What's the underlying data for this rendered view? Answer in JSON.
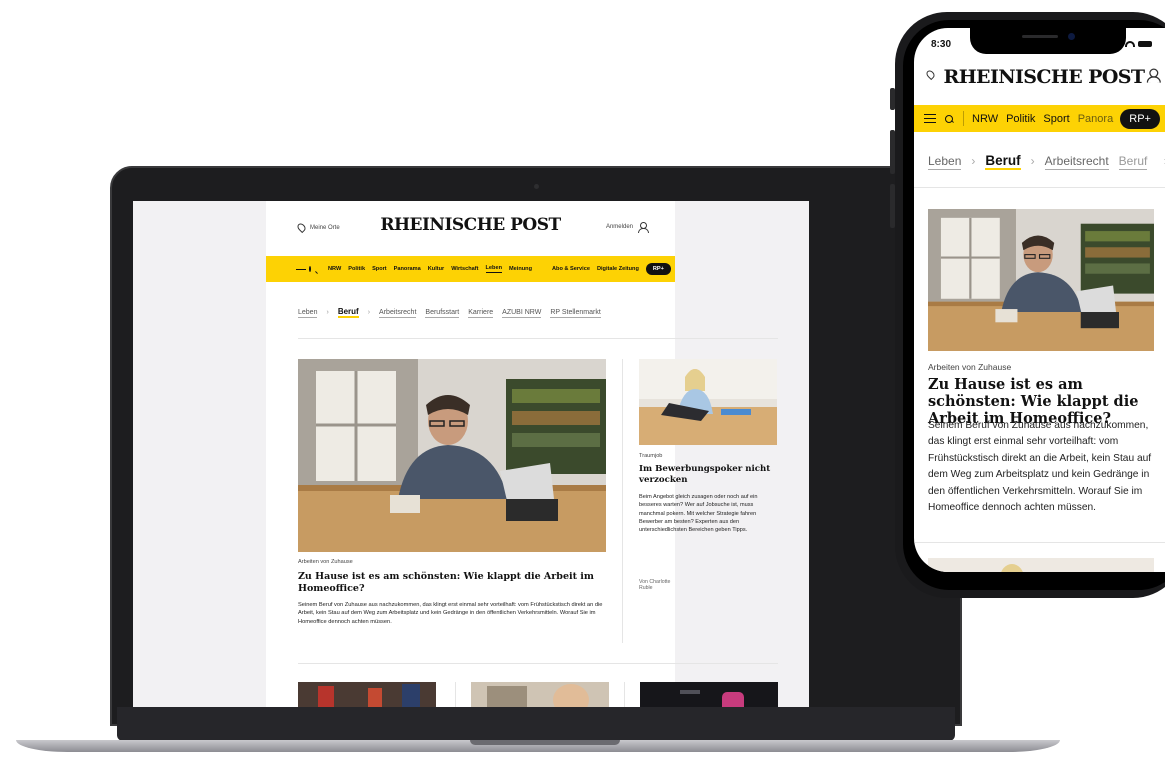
{
  "desktop": {
    "location_label": "Meine Orte",
    "logo": "RHEINISCHE POST",
    "login_label": "Anmelden",
    "nav": {
      "items": [
        "NRW",
        "Politik",
        "Sport",
        "Panorama",
        "Kultur",
        "Wirtschaft",
        "Leben",
        "Meinung",
        "Abo & Service",
        "Digitale Zeitung"
      ],
      "active": "Leben",
      "plus_label": "RP+"
    },
    "breadcrumb": {
      "parent": "Leben",
      "current": "Beruf",
      "children": [
        "Arbeitsrecht",
        "Berufsstart",
        "Karriere",
        "AZUBI NRW",
        "RP Stellenmarkt"
      ]
    },
    "lead": {
      "kicker": "Arbeiten von Zuhause",
      "headline": "Zu Hause ist es am schönsten: Wie klappt die Arbeit im Homeoffice?",
      "teaser": "Seinem Beruf von Zuhause aus nachzukommen, das klingt erst einmal sehr vorteilhaft: vom Frühstückstisch direkt an die Arbeit, kein Stau auf dem Weg zum Arbeitsplatz und kein Gedränge in den öffentlichen Verkehrsmitteln. Worauf Sie im Homeoffice dennoch achten müssen."
    },
    "second": {
      "kicker": "Traumjob",
      "headline": "Im Bewerbungspoker nicht verzocken",
      "teaser": "Beim Angebot gleich zusagen oder noch auf ein besseres warten? Wer auf Jobsuche ist, muss manchmal pokern. Mit welcher Strategie fahren Bewerber am besten? Experten aus den unterschiedlichsten Bereichen geben Tipps.",
      "author": "Von Charlotte Ruble"
    }
  },
  "mobile": {
    "time": "8:30",
    "logo": "RHEINISCHE POST",
    "nav": {
      "items": [
        "NRW",
        "Politik",
        "Sport"
      ],
      "truncated_item": "Panora",
      "plus_label": "RP+"
    },
    "breadcrumb": {
      "parent": "Leben",
      "current": "Beruf",
      "children": [
        "Arbeitsrecht",
        "Beruf"
      ]
    },
    "lead": {
      "kicker": "Arbeiten von Zuhause",
      "headline": "Zu Hause ist es am schönsten: Wie klappt die Arbeit im Homeoffice?",
      "teaser": "Seinem Beruf von Zuhause aus nachzukommen, das klingt erst einmal sehr vorteilhaft: vom Frühstückstisch direkt an die Arbeit, kein Stau auf dem Weg zum Arbeitsplatz und kein Gedränge in den öffentlichen Verkehrsmitteln. Worauf Sie im Homeoffice dennoch achten müssen."
    }
  },
  "colors": {
    "brand_yellow": "#fdd204",
    "text": "#111111",
    "device_frame": "#1d1d1f"
  },
  "icons": [
    "location-pin-icon",
    "user-icon",
    "hamburger-menu-icon",
    "search-icon",
    "chevron-right-icon",
    "signal-icon",
    "wifi-icon",
    "battery-icon"
  ]
}
